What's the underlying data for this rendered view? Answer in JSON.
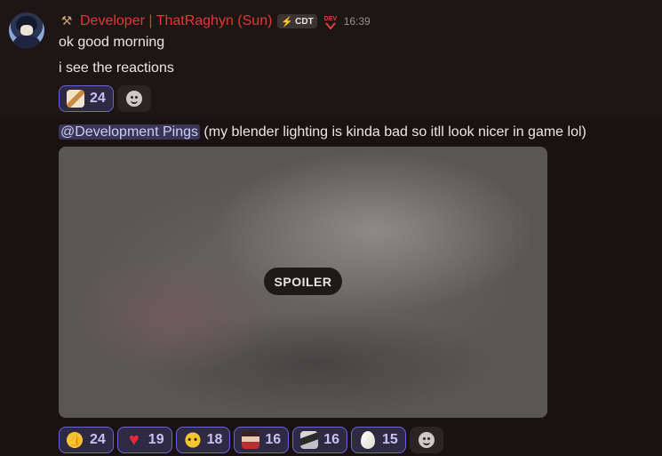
{
  "message1": {
    "username": "Developer | ThatRaghyn (Sun)",
    "tag_label": "CDT",
    "time": "16:39",
    "lines": [
      "ok good morning",
      "i see the reactions"
    ],
    "reactions": [
      {
        "icon": "custom-emoji-sticker-icon",
        "count": "24"
      }
    ]
  },
  "message2": {
    "mention": "@Development Pings",
    "text": " (my blender lighting is kinda bad so itll look nicer in game lol)",
    "spoiler_label": "SPOILER",
    "reactions": [
      {
        "icon": "thumbs-up-icon",
        "count": "24"
      },
      {
        "icon": "red-heart-icon",
        "count": "19"
      },
      {
        "icon": "pleading-face-icon",
        "count": "18"
      },
      {
        "icon": "custom-emoji-face-icon",
        "count": "16"
      },
      {
        "icon": "custom-emoji-person-icon",
        "count": "16"
      },
      {
        "icon": "egg-icon",
        "count": "15"
      }
    ]
  },
  "colors": {
    "username": "#e83535",
    "reaction_active_border": "#6b63d8",
    "mention_bg": "#3c3655"
  }
}
